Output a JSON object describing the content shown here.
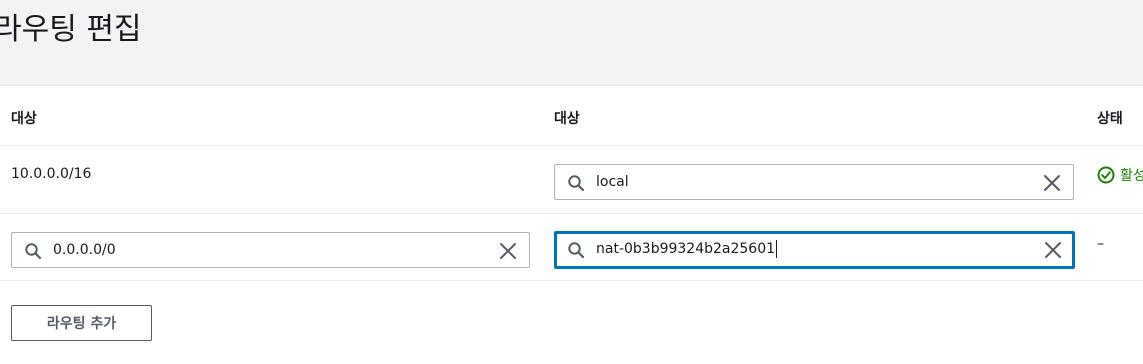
{
  "page": {
    "title": "라우팅 편집"
  },
  "table": {
    "columns": [
      "대상",
      "대상",
      "상태"
    ],
    "rows": [
      {
        "destination": "10.0.0.0/16",
        "target": "local",
        "status": "활성"
      },
      {
        "destination": "0.0.0.0/0",
        "target": "nat-0b3b99324b2a25601",
        "status": "–"
      }
    ]
  },
  "actions": {
    "add_route_label": "라우팅 추가"
  },
  "colors": {
    "accent": "#0073bb",
    "success": "#1d8102",
    "header_bg": "#f2f3f3",
    "border": "#aab7b8"
  },
  "icons": {
    "search": "search-icon",
    "clear": "close-icon",
    "status_ok": "check-circle-icon"
  }
}
